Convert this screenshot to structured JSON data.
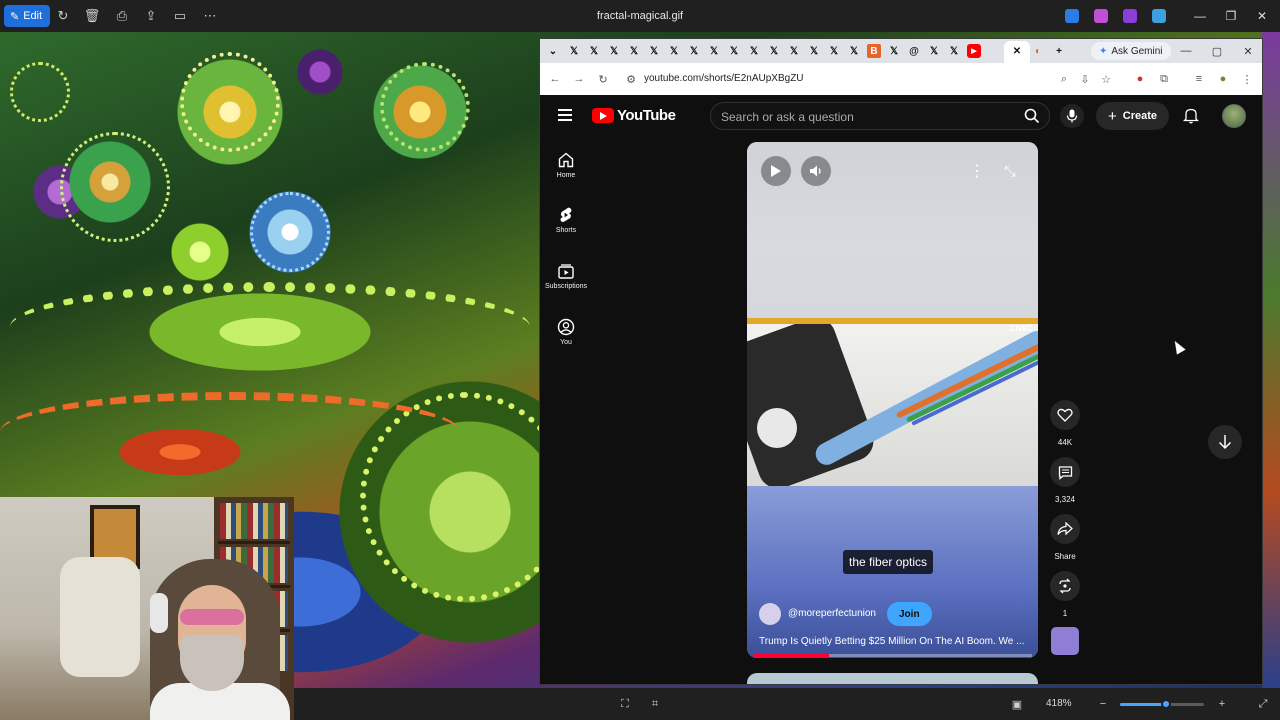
{
  "viewer": {
    "edit_label": "Edit",
    "file_title": "fractal-magical.gif",
    "zoom_level": "418%",
    "zoom_fraction": 0.55
  },
  "browser": {
    "url": "youtube.com/shorts/E2nAUpXBgZU",
    "gemini_label": "Ask Gemini"
  },
  "youtube": {
    "logo_text": "YouTube",
    "search_placeholder": "Search or ask a question",
    "create_label": "Create",
    "sidebar": [
      {
        "label": "Home",
        "icon": "home-icon"
      },
      {
        "label": "Shorts",
        "icon": "shorts-icon"
      },
      {
        "label": "Subscriptions",
        "icon": "subscriptions-icon"
      },
      {
        "label": "You",
        "icon": "you-icon"
      }
    ],
    "short": {
      "watermark": "CNBC",
      "caption": "the fiber optics",
      "channel": "@moreperfectunion",
      "join_label": "Join",
      "title": "Trump Is Quietly Betting $25 Million On The AI Boom. We ...",
      "progress_fraction": 0.27
    },
    "actions": {
      "likes": "44K",
      "comments": "3,324",
      "share": "Share",
      "remix": "1"
    }
  },
  "colors": {
    "accent_blue": "#3ea6ff",
    "youtube_red": "#ff0000",
    "edit_blue": "#1e6fd9"
  }
}
